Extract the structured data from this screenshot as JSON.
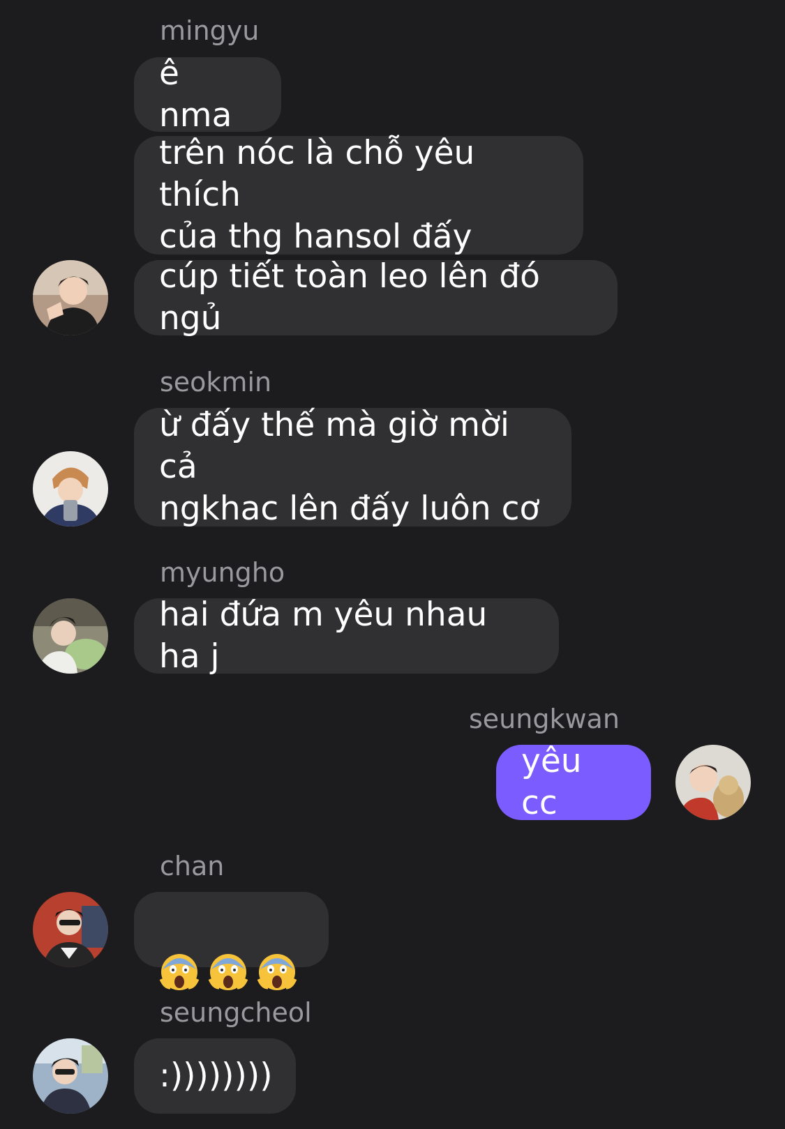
{
  "chat": {
    "groups": [
      {
        "sender": "mingyu",
        "messages": [
          "ê nma",
          "trên nóc là chỗ yêu thích\ncủa thg hansol đấy",
          "cúp tiết toàn leo lên đó ngủ"
        ]
      },
      {
        "sender": "seokmin",
        "messages": [
          "ừ đấy thế mà giờ mời cả\nngkhac lên đấy luôn cơ"
        ]
      },
      {
        "sender": "myungho",
        "messages": [
          "hai đứa m yêu nhau ha j"
        ]
      },
      {
        "sender": "seungkwan",
        "messages": [
          "yêu cc"
        ],
        "outgoing": true
      },
      {
        "sender": "chan",
        "messages": [
          "😱😱😱"
        ],
        "emoji_icon": "face-screaming-in-fear-icon"
      },
      {
        "sender": "seungcheol",
        "messages": [
          ":))))))))"
        ]
      }
    ]
  },
  "colors": {
    "background": "#1c1c1e",
    "incoming_bubble": "#303033",
    "outgoing_bubble": "#7b5cff",
    "sender_name": "#9a9a9e"
  }
}
